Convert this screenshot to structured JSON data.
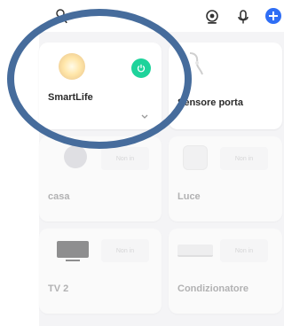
{
  "devices": [
    {
      "name": "SmartLife",
      "status": "",
      "power": true
    },
    {
      "name": "Sensore porta",
      "status": ""
    },
    {
      "name": "casa",
      "status": "Non in"
    },
    {
      "name": "Luce",
      "status": "Non in"
    },
    {
      "name": "TV 2",
      "status": "Non in"
    },
    {
      "name": "Condizionatore",
      "status": "Non in"
    }
  ],
  "colors": {
    "accent_blue": "#2f6ef5",
    "power_green": "#1ed39b",
    "ring": "#466c9c"
  }
}
